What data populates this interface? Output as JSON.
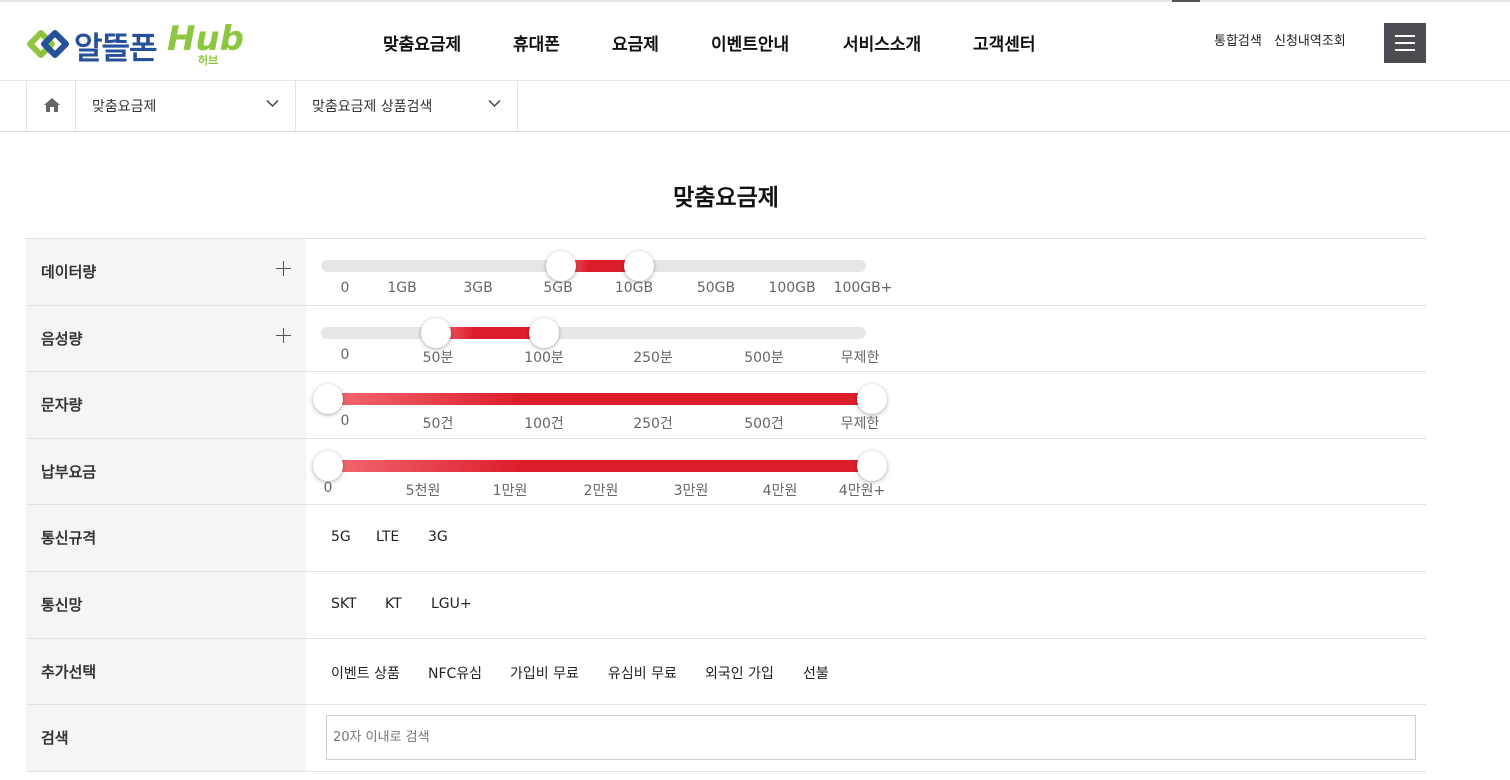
{
  "logo": {
    "name_kr": "알뜰폰",
    "name_en": "Hub",
    "sub": "허브",
    "colors": {
      "blue": "#27509b",
      "green": "#8dc63f"
    },
    "icon": "link-rings-icon"
  },
  "nav": {
    "items": [
      {
        "label": "맞춤요금제"
      },
      {
        "label": "휴대폰"
      },
      {
        "label": "요금제"
      },
      {
        "label": "이벤트안내"
      },
      {
        "label": "서비스소개"
      },
      {
        "label": "고객센터"
      }
    ],
    "util": [
      {
        "label": "통합검색"
      },
      {
        "label": "신청내역조회"
      }
    ],
    "menu_icon": "hamburger-icon"
  },
  "breadcrumb": {
    "home_icon": "home-icon",
    "items": [
      {
        "label": "맞춤요금제",
        "icon": "chevron-down-icon"
      },
      {
        "label": "맞춤요금제 상품검색",
        "icon": "chevron-down-icon"
      }
    ]
  },
  "page": {
    "title": "맞춤요금제"
  },
  "filters": {
    "data": {
      "label": "데이터량",
      "ticks": [
        "0",
        "1GB",
        "3GB",
        "5GB",
        "10GB",
        "50GB",
        "100GB",
        "100GB+"
      ],
      "selected_range": [
        "5GB",
        "10GB"
      ]
    },
    "voice": {
      "label": "음성량",
      "ticks": [
        "0",
        "50분",
        "100분",
        "250분",
        "500분",
        "무제한"
      ],
      "selected_range": [
        "50분",
        "100분"
      ]
    },
    "sms": {
      "label": "문자량",
      "ticks": [
        "0",
        "50건",
        "100건",
        "250건",
        "500건",
        "무제한"
      ],
      "selected_range": [
        "0",
        "무제한"
      ]
    },
    "fee": {
      "label": "납부요금",
      "ticks": [
        "0",
        "5천원",
        "1만원",
        "2만원",
        "3만원",
        "4만원",
        "4만원+"
      ],
      "selected_range": [
        "0",
        "4만원+"
      ]
    },
    "network_type": {
      "label": "통신규격",
      "options": [
        {
          "label": "5G"
        },
        {
          "label": "LTE"
        },
        {
          "label": "3G"
        }
      ]
    },
    "carrier": {
      "label": "통신망",
      "options": [
        {
          "label": "SKT"
        },
        {
          "label": "KT"
        },
        {
          "label": "LGU+"
        }
      ]
    },
    "extra": {
      "label": "추가선택",
      "options": [
        {
          "label": "이벤트 상품"
        },
        {
          "label": "NFC유심"
        },
        {
          "label": "가입비 무료"
        },
        {
          "label": "유심비 무료"
        },
        {
          "label": "외국인 가입"
        },
        {
          "label": "선불"
        }
      ]
    },
    "search": {
      "label": "검색",
      "placeholder": "20자 이내로 검색",
      "value": ""
    }
  },
  "colors": {
    "accent": "#dc1e2c",
    "track": "#e6e6e6",
    "header_dark": "#4a4c52"
  }
}
